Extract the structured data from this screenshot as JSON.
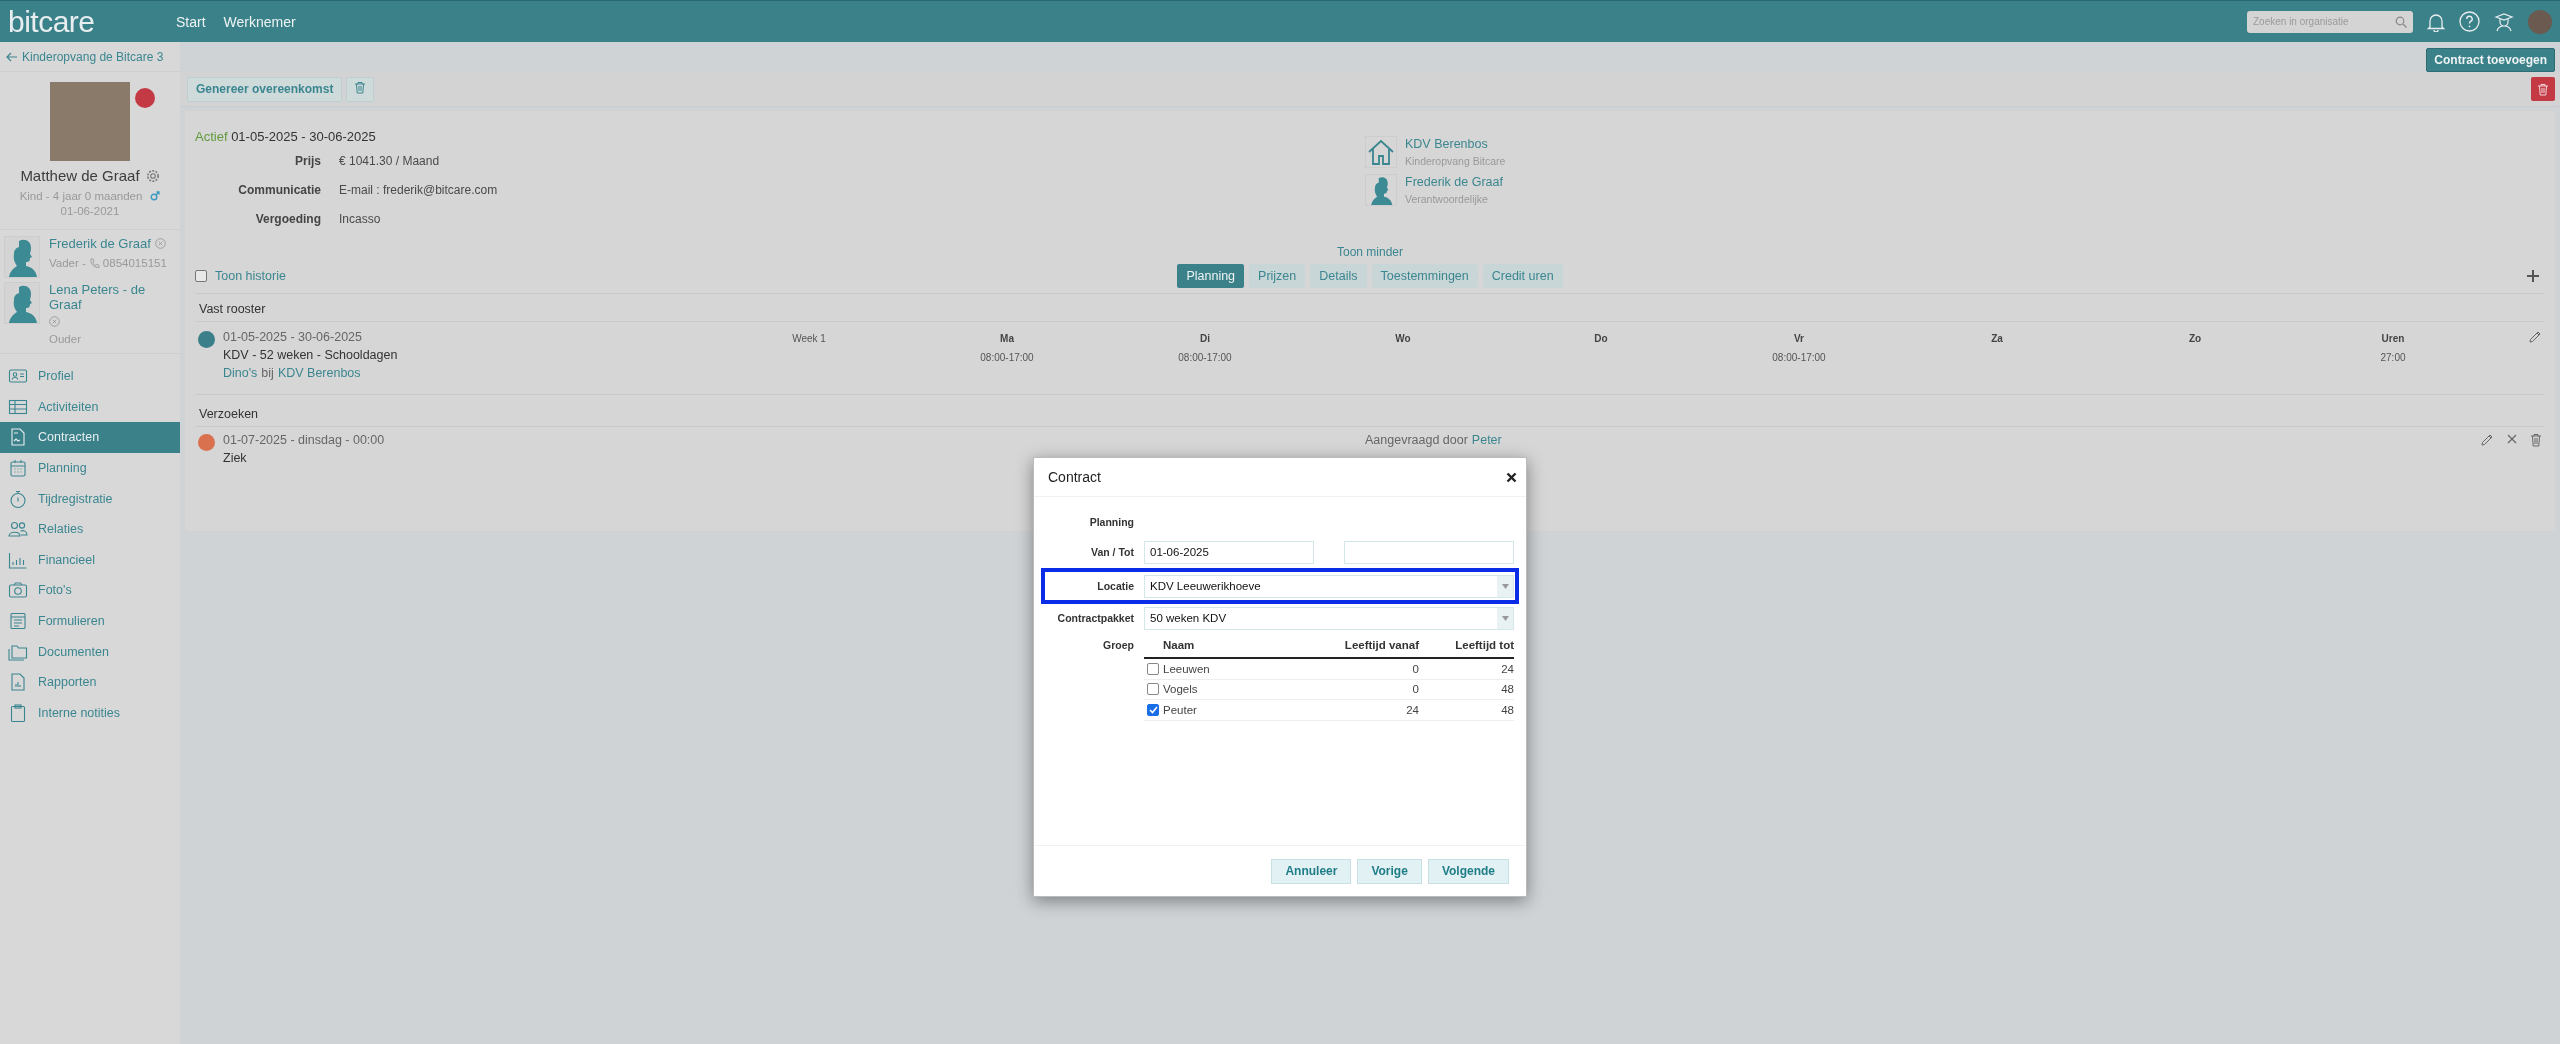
{
  "header": {
    "logo": "bitcare",
    "nav": [
      {
        "label": "Start"
      },
      {
        "label": "Werknemer"
      }
    ],
    "search": {
      "placeholder": "Zoeken in organisatie"
    }
  },
  "sidebar": {
    "back_link": "Kinderopvang de Bitcare 3",
    "child": {
      "name": "Matthew de Graaf",
      "info": "Kind - 4 jaar 0 maanden",
      "birthdate": "01-06-2021"
    },
    "relations": [
      {
        "name": "Frederik de Graaf",
        "role": "Vader -",
        "phone": "0854015151"
      },
      {
        "name": "Lena Peters - de Graaf",
        "role": "Ouder"
      }
    ],
    "menu": [
      {
        "label": "Profiel",
        "selected": false
      },
      {
        "label": "Activiteiten",
        "selected": false
      },
      {
        "label": "Contracten",
        "selected": true
      },
      {
        "label": "Planning",
        "selected": false
      },
      {
        "label": "Tijdregistratie",
        "selected": false
      },
      {
        "label": "Relaties",
        "selected": false
      },
      {
        "label": "Financieel",
        "selected": false
      },
      {
        "label": "Foto's",
        "selected": false
      },
      {
        "label": "Formulieren",
        "selected": false
      },
      {
        "label": "Documenten",
        "selected": false
      },
      {
        "label": "Rapporten",
        "selected": false
      },
      {
        "label": "Interne notities",
        "selected": false
      }
    ]
  },
  "toolbar": {
    "add_button": "Contract toevoegen",
    "generate_button": "Genereer overeenkomst"
  },
  "contract": {
    "status": "Actief",
    "period": "01-05-2025 - 30-06-2025",
    "fields": [
      {
        "label": "Prijs",
        "value": "€ 1041.30 / Maand"
      },
      {
        "label": "Communicatie",
        "value": "E-mail : frederik@bitcare.com"
      },
      {
        "label": "Vergoeding",
        "value": "Incasso"
      }
    ],
    "location": {
      "name": "KDV Berenbos",
      "organisation": "Kinderopvang Bitcare"
    },
    "responsible": {
      "name": "Frederik de Graaf",
      "role": "Verantwoordelijke"
    },
    "toggle_link": "Toon minder",
    "show_history": {
      "label": "Toon historie",
      "checked": false
    },
    "tabs": [
      {
        "label": "Planning",
        "selected": true
      },
      {
        "label": "Prijzen",
        "selected": false
      },
      {
        "label": "Details",
        "selected": false
      },
      {
        "label": "Toestemmingen",
        "selected": false
      },
      {
        "label": "Credit uren",
        "selected": false
      }
    ],
    "schedule": {
      "title": "Vast rooster",
      "entries": [
        {
          "color": "#3a7f89",
          "period": "01-05-2025 - 30-06-2025",
          "package": "KDV - 52 weken - Schooldagen",
          "group": "Dino's",
          "connector": "bij",
          "location": "KDV Berenbos",
          "week": "Week 1",
          "days": [
            {
              "day": "Ma",
              "time": "08:00-17:00"
            },
            {
              "day": "Di",
              "time": "08:00-17:00"
            },
            {
              "day": "Wo"
            },
            {
              "day": "Do"
            },
            {
              "day": "Vr",
              "time": "08:00-17:00"
            },
            {
              "day": "Za"
            },
            {
              "day": "Zo"
            }
          ],
          "hours_label": "Uren",
          "hours": "27:00"
        }
      ]
    },
    "requests": {
      "title": "Verzoeken",
      "entries": [
        {
          "color": "#d9714f",
          "date": "01-07-2025 - dinsdag - 00:00",
          "reason": "Ziek",
          "requested_label": "Aangevraagd door",
          "requested_by": "Peter"
        }
      ]
    }
  },
  "modal": {
    "title": "Contract",
    "section": "Planning",
    "period": {
      "label": "Van / Tot",
      "from": "01-06-2025"
    },
    "selects": [
      {
        "label": "Locatie",
        "value": "KDV Leeuwerikhoeve",
        "highlighted": true
      },
      {
        "label": "Contractpakket",
        "value": "50 weken KDV",
        "highlighted": false
      }
    ],
    "groups": {
      "label": "Groep",
      "columns": [
        "Naam",
        "Leeftijd vanaf",
        "Leeftijd tot"
      ],
      "rows": [
        {
          "name": "Leeuwen",
          "from": "0",
          "to": "24",
          "checked": false
        },
        {
          "name": "Vogels",
          "from": "0",
          "to": "48",
          "checked": false
        },
        {
          "name": "Peuter",
          "from": "24",
          "to": "48",
          "checked": true
        }
      ]
    },
    "buttons": [
      "Annuleer",
      "Vorige",
      "Volgende"
    ]
  }
}
